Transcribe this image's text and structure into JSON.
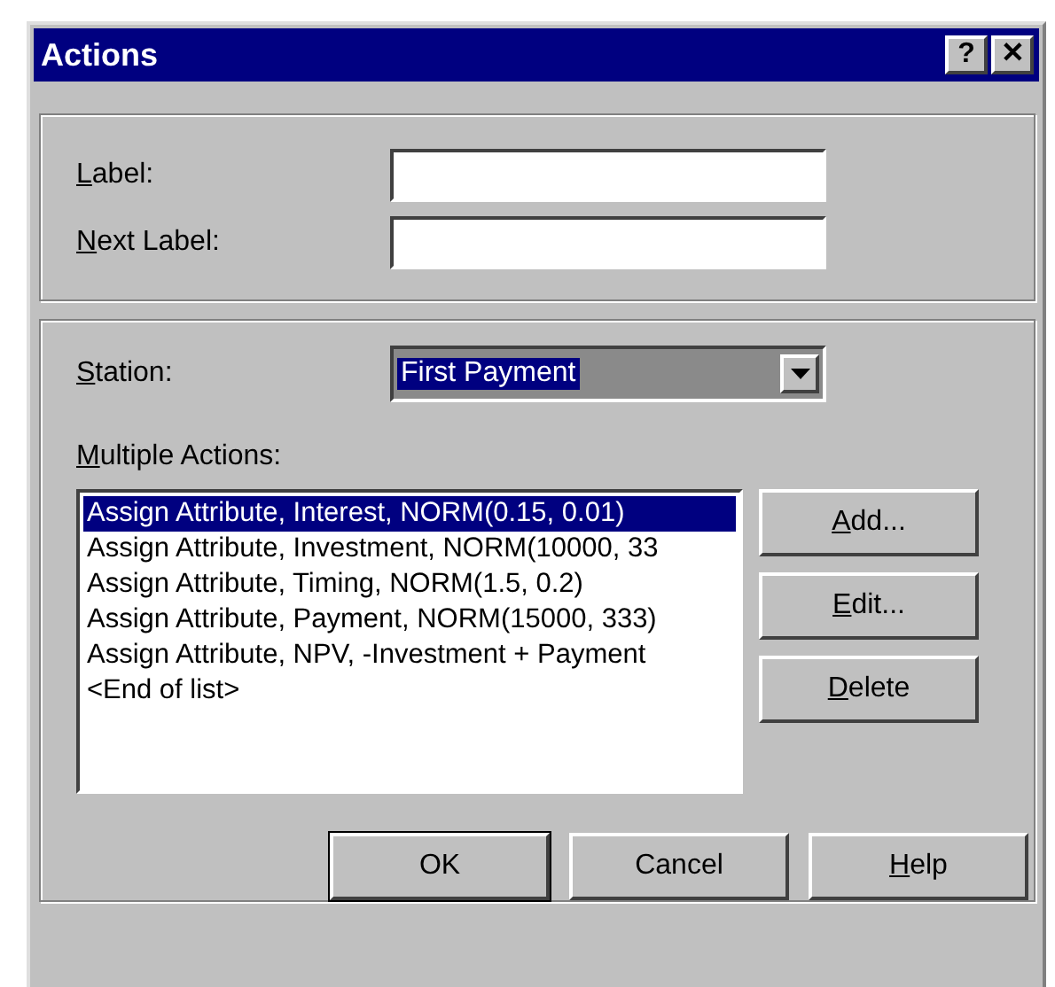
{
  "window": {
    "title": "Actions",
    "title_buttons": [
      "?",
      "✕"
    ]
  },
  "fields": [
    {
      "label": "Label:",
      "mnemonic": true
    },
    {
      "label": "Next Label:",
      "mnemonic": true
    }
  ],
  "station": {
    "label": "Station:",
    "mnemonic": true,
    "value": "First Payment",
    "selected": true
  },
  "actions": {
    "label": "Multiple Actions:",
    "mnemonic": true,
    "items": [
      {
        "text": "Assign Attribute, Interest, NORM(0.15, 0.01)",
        "selected": true
      },
      {
        "text": "Assign Attribute, Investment, NORM(10000, 33",
        "selected": false
      },
      {
        "text": "Assign Attribute, Timing, NORM(1.5, 0.2)",
        "selected": false
      },
      {
        "text": "Assign Attribute, Payment, NORM(15000, 333)",
        "selected": false
      },
      {
        "text": "Assign Attribute, NPV, -Investment + Payment",
        "selected": false
      },
      {
        "text": "<End of list>",
        "selected": false
      }
    ]
  },
  "side_buttons": [
    {
      "label": "Add...",
      "mnemonic": true
    },
    {
      "label": "Edit...",
      "mnemonic": true
    },
    {
      "label": "Delete",
      "mnemonic": true
    }
  ],
  "buttons": [
    {
      "label": "OK",
      "mnemonic": false,
      "default": true
    },
    {
      "label": "Cancel",
      "mnemonic": false,
      "default": false
    },
    {
      "label": "Help",
      "mnemonic": true,
      "default": false
    }
  ]
}
